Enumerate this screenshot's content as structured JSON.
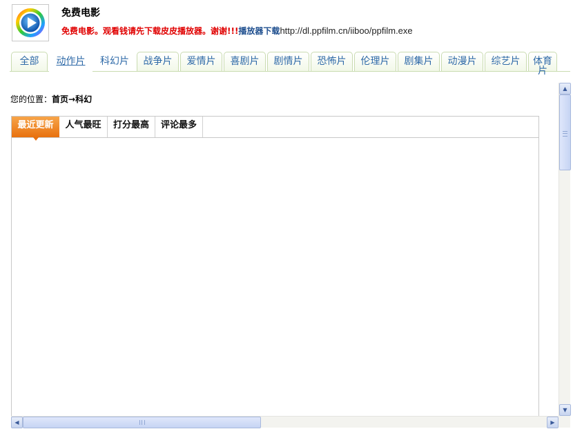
{
  "header": {
    "title": "免费电影",
    "notice_red": "免费电影。观看钱请先下载皮皮播放器。谢谢!!!",
    "notice_link": "播放器下载",
    "notice_url": "http://dl.ppfilm.cn/iiboo/ppfilm.exe"
  },
  "categories": [
    {
      "label": "全部"
    },
    {
      "label": "动作片"
    },
    {
      "label": "科幻片"
    },
    {
      "label": "战争片"
    },
    {
      "label": "爱情片"
    },
    {
      "label": "喜剧片"
    },
    {
      "label": "剧情片"
    },
    {
      "label": "恐怖片"
    },
    {
      "label": "伦理片"
    },
    {
      "label": "剧集片"
    },
    {
      "label": "动漫片"
    },
    {
      "label": "综艺片"
    },
    {
      "label": "体育片"
    }
  ],
  "breadcrumb": {
    "prefix": "您的位置：",
    "path": "首页→科幻"
  },
  "sort_tabs": [
    {
      "label": "最近更新",
      "active": true
    },
    {
      "label": "人气最旺",
      "active": false
    },
    {
      "label": "打分最高",
      "active": false
    },
    {
      "label": "评论最多",
      "active": false
    }
  ],
  "colors": {
    "link_blue": "#2f6aa8",
    "notice_red": "#e00000",
    "active_tab_orange": "#e8710e",
    "tab_border_green": "#c9dbb0"
  }
}
